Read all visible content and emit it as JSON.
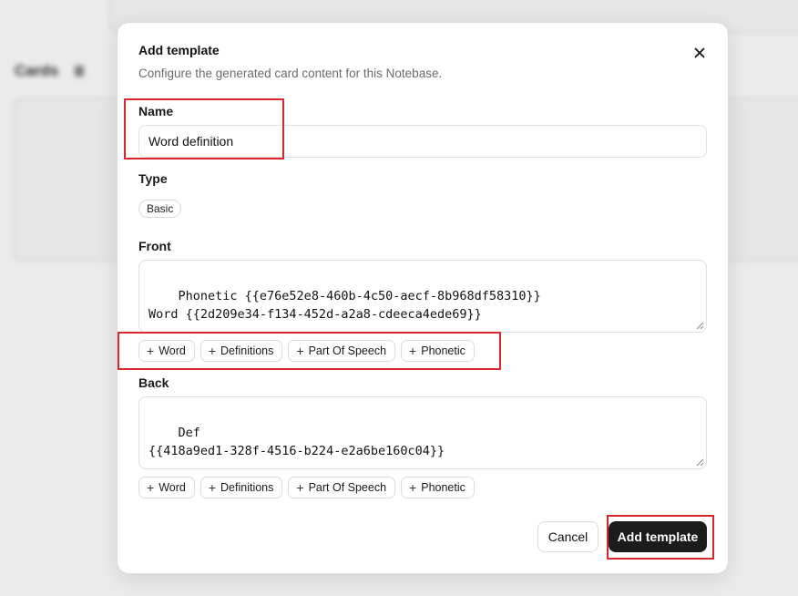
{
  "background": {
    "section_heading": "Cards"
  },
  "dialog": {
    "title": "Add template",
    "description": "Configure the generated card content for this Notebase.",
    "close_icon": "close-icon"
  },
  "name_field": {
    "label": "Name",
    "value": "Word definition"
  },
  "type_field": {
    "label": "Type",
    "value": "Basic"
  },
  "front_field": {
    "label": "Front",
    "value": "Phonetic {{e76e52e8-460b-4c50-aecf-8b968df58310}}\nWord {{2d209e34-f134-452d-a2a8-cdeeca4ede69}}",
    "chips": [
      "Word",
      "Definitions",
      "Part Of Speech",
      "Phonetic"
    ]
  },
  "back_field": {
    "label": "Back",
    "value": "Def\n{{418a9ed1-328f-4516-b224-e2a6be160c04}}",
    "chips": [
      "Word",
      "Definitions",
      "Part Of Speech",
      "Phonetic"
    ]
  },
  "actions": {
    "cancel_label": "Cancel",
    "submit_label": "Add template"
  },
  "colors": {
    "highlight": "#d9262c",
    "primary_button": "#1c1c1c"
  }
}
